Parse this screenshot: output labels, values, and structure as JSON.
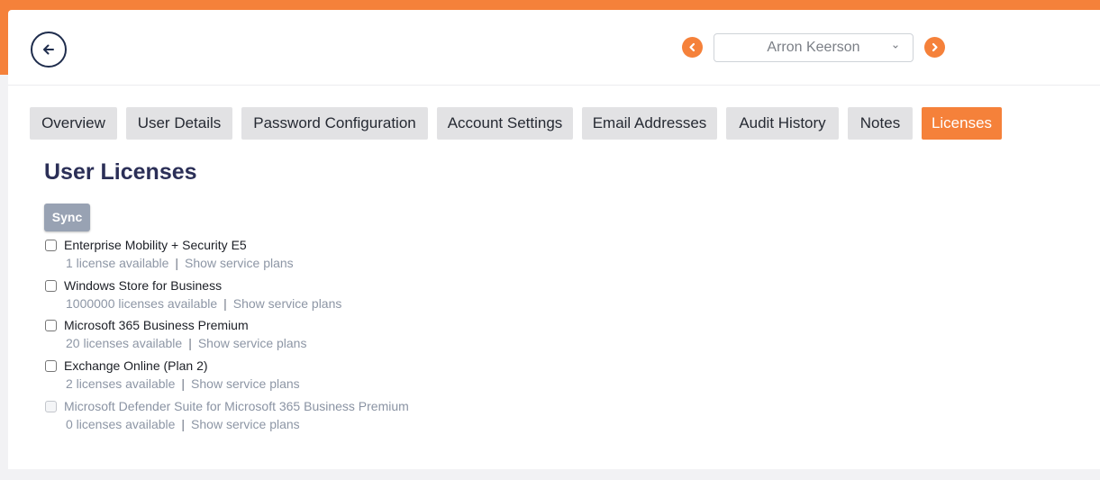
{
  "colors": {
    "accent": "#f5813a",
    "navy": "#1f2d4d",
    "title": "#2b2f57",
    "tab_bg": "#e2e2e4",
    "muted": "#8d96a5"
  },
  "header": {
    "back_icon": "arrow-left-icon",
    "prev_icon": "chevron-left-icon",
    "next_icon": "chevron-right-icon",
    "selected_user": "Arron Keerson"
  },
  "tabs": [
    {
      "label": "Overview",
      "active": false
    },
    {
      "label": "User Details",
      "active": false
    },
    {
      "label": "Password Configuration",
      "active": false
    },
    {
      "label": "Account Settings",
      "active": false
    },
    {
      "label": "Email Addresses",
      "active": false
    },
    {
      "label": "Audit History",
      "active": false
    },
    {
      "label": "Notes",
      "active": false
    },
    {
      "label": "Licenses",
      "active": true
    }
  ],
  "main": {
    "title": "User Licenses",
    "sync_label": "Sync",
    "licenses": [
      {
        "name": "Enterprise Mobility + Security E5",
        "availability": "1 license available",
        "link": "Show service plans",
        "checked": false,
        "disabled": false
      },
      {
        "name": "Windows Store for Business",
        "availability": "1000000 licenses available",
        "link": "Show service plans",
        "checked": false,
        "disabled": false
      },
      {
        "name": "Microsoft 365 Business Premium",
        "availability": "20 licenses available",
        "link": "Show service plans",
        "checked": false,
        "disabled": false
      },
      {
        "name": "Exchange Online (Plan 2)",
        "availability": "2 licenses available",
        "link": "Show service plans",
        "checked": false,
        "disabled": false
      },
      {
        "name": "Microsoft Defender Suite for Microsoft 365 Business Premium",
        "availability": "0 licenses available",
        "link": "Show service plans",
        "checked": false,
        "disabled": true
      }
    ],
    "separator": "|"
  }
}
